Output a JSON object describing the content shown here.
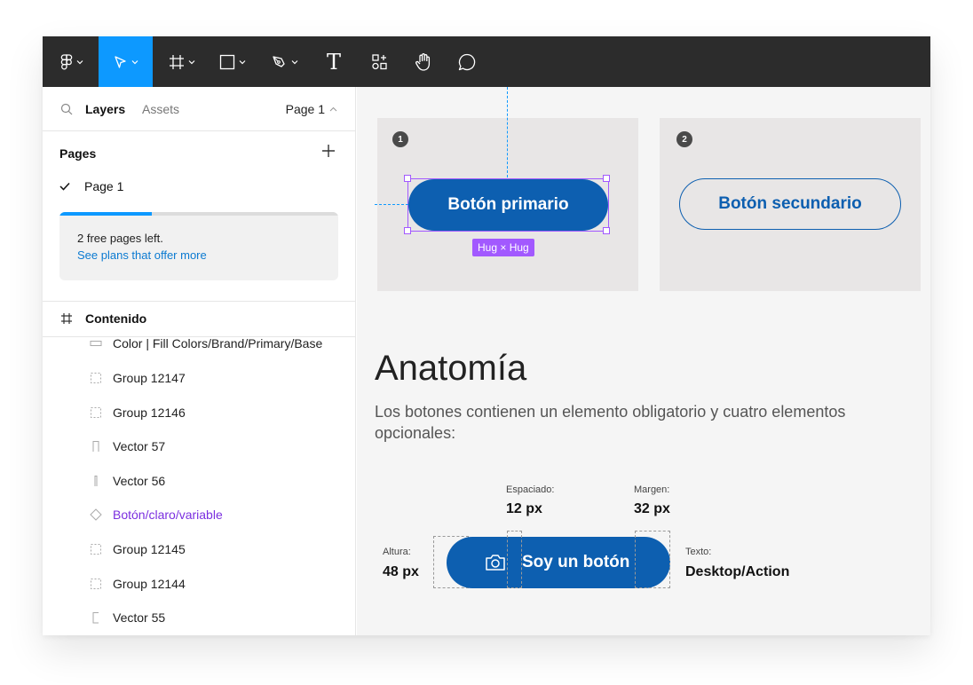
{
  "toolbar": {
    "tools": [
      {
        "name": "main-menu",
        "icon": "figma-logo-icon"
      },
      {
        "name": "move-tool",
        "icon": "cursor-icon",
        "active": true
      },
      {
        "name": "frame-tool",
        "icon": "frame-hash-icon"
      },
      {
        "name": "shape-tool",
        "icon": "rectangle-icon"
      },
      {
        "name": "pen-tool",
        "icon": "pen-icon"
      },
      {
        "name": "text-tool",
        "icon": "text-icon",
        "glyph": "T"
      },
      {
        "name": "resources-tool",
        "icon": "resources-icon"
      },
      {
        "name": "hand-tool",
        "icon": "hand-icon"
      },
      {
        "name": "comment-tool",
        "icon": "comment-bubble-icon"
      }
    ],
    "accent": "#0d99ff",
    "background": "#2c2c2c"
  },
  "left_panel": {
    "tabs": {
      "layers": "Layers",
      "assets": "Assets"
    },
    "page_selector": "Page 1",
    "pages_title": "Pages",
    "current_page": "Page 1",
    "promo": {
      "line1": "2 free pages left.",
      "link": "See plans that offer more",
      "progress": 0.33
    },
    "frame_name": "Contenido",
    "layers": [
      {
        "label": "Color | Fill Colors/Brand/Primary/Base",
        "icon": "rectangle-layer-icon"
      },
      {
        "label": "Group 12147",
        "icon": "group-layer-icon"
      },
      {
        "label": "Group 12146",
        "icon": "group-layer-icon"
      },
      {
        "label": "Vector 57",
        "icon": "vector-layer-icon"
      },
      {
        "label": "Vector 56",
        "icon": "vector-layer-icon"
      },
      {
        "label": "Botón/claro/variable",
        "icon": "component-instance-icon",
        "color": "#7b2fe0"
      },
      {
        "label": "Group 12145",
        "icon": "group-layer-icon"
      },
      {
        "label": "Group 12144",
        "icon": "group-layer-icon"
      },
      {
        "label": "Vector 55",
        "icon": "vector-layer-icon"
      }
    ]
  },
  "canvas": {
    "cards": [
      {
        "badge": "1",
        "button": "Botón primario",
        "hug_label": "Hug × Hug"
      },
      {
        "badge": "2",
        "button": "Botón secundario"
      }
    ],
    "heading": "Anatomía",
    "description": "Los botones contienen un elemento obligatorio y cuatro elementos opcionales:",
    "annotations": {
      "spacing_label": "Espaciado:",
      "spacing_value": "12 px",
      "margin_label": "Margen:",
      "margin_value": "32 px",
      "height_label": "Altura:",
      "height_value": "48 px",
      "text_label": "Texto:",
      "text_value": "Desktop/Action"
    },
    "anatomy_button": "Soy un botón",
    "brand_color": "#0d5fb0",
    "selection_color": "#a259ff"
  }
}
